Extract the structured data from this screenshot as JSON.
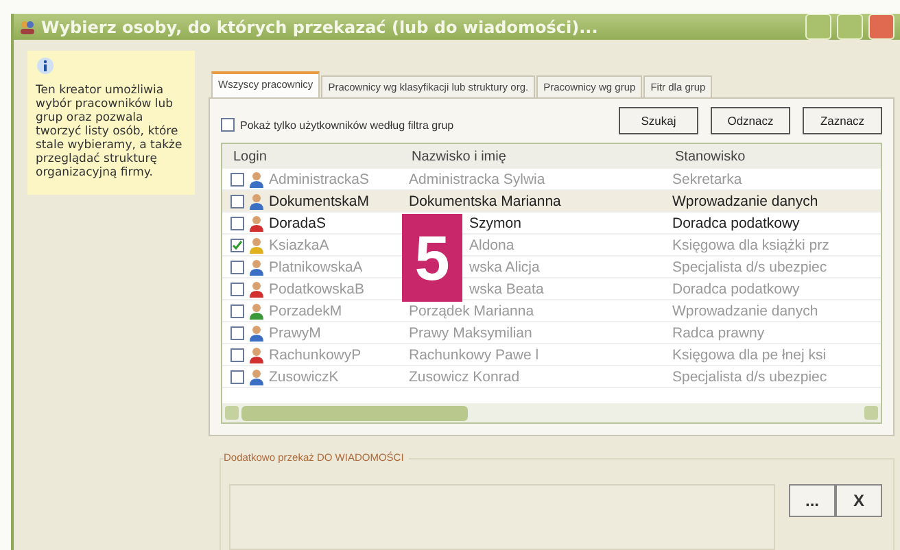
{
  "window": {
    "title": "Wybierz osoby, do których przekazać (lub do wiadomości)..."
  },
  "info_panel": {
    "text": "Ten kreator umożliwia wybór pracowników lub grup oraz pozwala tworzyć listy osób, które stale wybieramy, a także przeglądać strukturę organizacyjną firmy."
  },
  "tabs": [
    {
      "label": "Wszyscy pracownicy",
      "selected": true
    },
    {
      "label": "Pracownicy wg klasyfikacji lub struktury org.",
      "selected": false
    },
    {
      "label": "Pracownicy wg grup",
      "selected": false
    },
    {
      "label": "Fitr dla grup",
      "selected": false
    }
  ],
  "filter_checkbox": {
    "label": "Pokaż tylko użytkowników według filtra grup",
    "checked": false
  },
  "buttons": [
    "Szukaj",
    "Odznacz",
    "Zaznacz"
  ],
  "table": {
    "columns": [
      "Login",
      "Nazwisko i imię",
      "Stanowisko"
    ],
    "rows": [
      {
        "login": "AdministrackaS",
        "name": "Administracka Sylwia",
        "position": "Sekretarka",
        "checked": false,
        "selected": false,
        "disabled": true,
        "covered": false,
        "color": "#3b6fc4"
      },
      {
        "login": "DokumentskaM",
        "name": "Dokumentska Marianna",
        "position": "Wprowadzanie danych",
        "checked": false,
        "selected": true,
        "disabled": false,
        "covered": false,
        "color": "#3b6fc4"
      },
      {
        "login": "DoradaS",
        "name": "Szymon",
        "position": "Doradca podatkowy",
        "checked": false,
        "selected": false,
        "disabled": false,
        "covered": true,
        "color": "#d03030"
      },
      {
        "login": "KsiazkaA",
        "name": "Aldona",
        "position": "Księgowa dla książki prz",
        "checked": true,
        "selected": false,
        "disabled": true,
        "covered": true,
        "color": "#e0b020"
      },
      {
        "login": "PlatnikowskaA",
        "name": "wska Alicja",
        "position": "Specjalista d/s ubezpiec",
        "checked": false,
        "selected": false,
        "disabled": true,
        "covered": true,
        "color": "#3b6fc4"
      },
      {
        "login": "PodatkowskaB",
        "name": "wska Beata",
        "position": "Doradca podatkowy",
        "checked": false,
        "selected": false,
        "disabled": true,
        "covered": true,
        "color": "#d03030"
      },
      {
        "login": "PorzadekM",
        "name": "Porządek Marianna",
        "position": "Wprowadzanie danych",
        "checked": false,
        "selected": false,
        "disabled": true,
        "covered": false,
        "color": "#3a9a3a"
      },
      {
        "login": "PrawyM",
        "name": "Prawy Maksymilian",
        "position": "Radca prawny",
        "checked": false,
        "selected": false,
        "disabled": true,
        "covered": false,
        "color": "#3b6fc4"
      },
      {
        "login": "RachunkowyP",
        "name": "Rachunkowy Pawe l",
        "position": "Księgowa dla pe łnej ksi",
        "checked": false,
        "selected": false,
        "disabled": true,
        "covered": false,
        "color": "#d03030"
      },
      {
        "login": "ZusowiczK",
        "name": "Zusowicz Konrad",
        "position": "Specjalista d/s ubezpiec",
        "checked": false,
        "selected": false,
        "disabled": true,
        "covered": false,
        "color": "#3b6fc4"
      }
    ]
  },
  "badge": "5",
  "cc_group": {
    "title": "Dodatkowo przekaż DO WIADOMOŚCI",
    "buttons": [
      "...",
      "X"
    ]
  }
}
